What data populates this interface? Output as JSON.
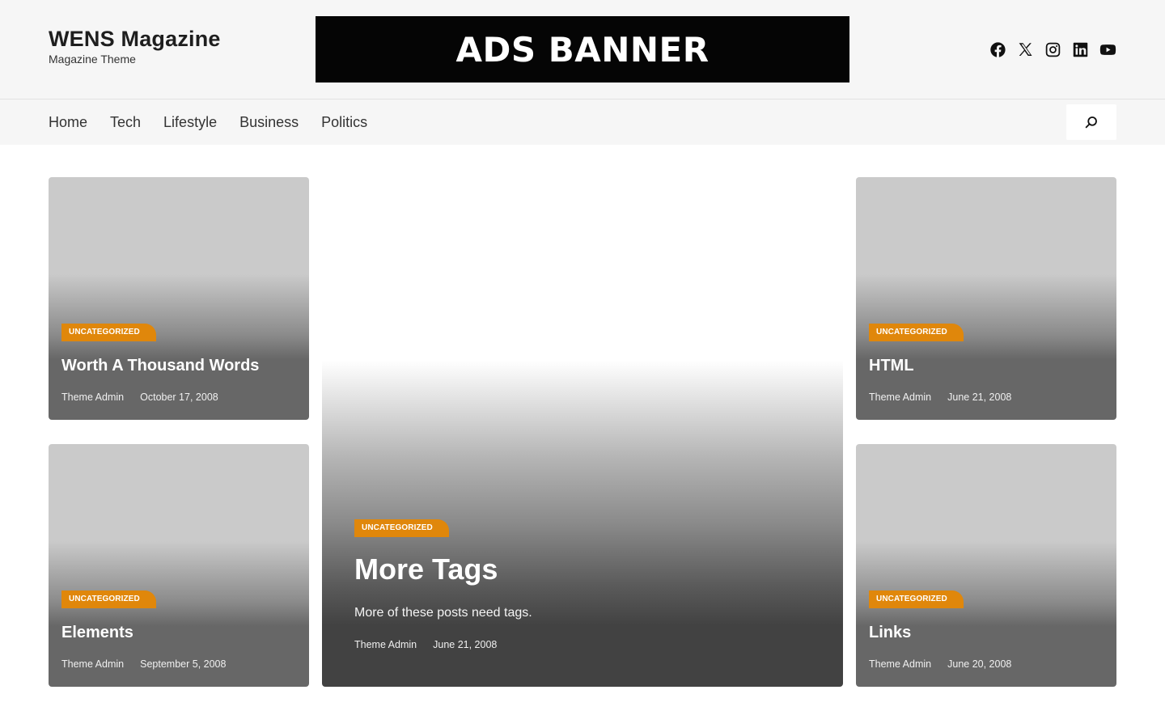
{
  "site": {
    "title": "WENS Magazine",
    "tagline": "Magazine Theme"
  },
  "ads": {
    "label": "ADS BANNER"
  },
  "social": [
    "facebook-icon",
    "x-icon",
    "instagram-icon",
    "linkedin-icon",
    "youtube-icon"
  ],
  "nav": {
    "items": [
      {
        "label": "Home"
      },
      {
        "label": "Tech"
      },
      {
        "label": "Lifestyle"
      },
      {
        "label": "Business"
      },
      {
        "label": "Politics"
      }
    ]
  },
  "colors": {
    "accent": "#e0870b",
    "topbar": "#f6f6f6"
  },
  "posts": [
    {
      "category": "UNCATEGORIZED",
      "title": "Worth A Thousand Words",
      "author": "Theme Admin",
      "date": "October 17, 2008"
    },
    {
      "category": "UNCATEGORIZED",
      "title": "Elements",
      "author": "Theme Admin",
      "date": "September 5, 2008"
    },
    {
      "category": "UNCATEGORIZED",
      "title": "More Tags",
      "excerpt": "More of these posts need tags.",
      "author": "Theme Admin",
      "date": "June 21, 2008"
    },
    {
      "category": "UNCATEGORIZED",
      "title": "HTML",
      "author": "Theme Admin",
      "date": "June 21, 2008"
    },
    {
      "category": "UNCATEGORIZED",
      "title": "Links",
      "author": "Theme Admin",
      "date": "June 20, 2008"
    }
  ]
}
